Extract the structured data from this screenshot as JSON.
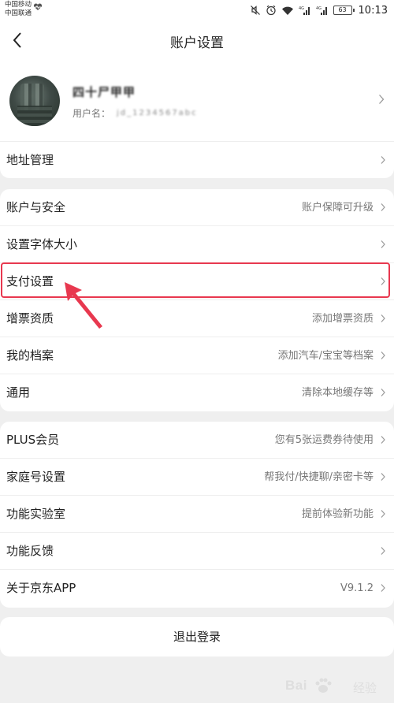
{
  "status_bar": {
    "carrier_1": "中国移动",
    "carrier_2": "中国联通",
    "battery": "63",
    "time": "10:13"
  },
  "nav": {
    "title": "账户设置",
    "back_icon": "chevron-left-icon"
  },
  "profile": {
    "nickname": "四十尸甲甲",
    "username_label": "用户名：",
    "username_value": "jd_1234567abc"
  },
  "group1": [
    {
      "label": "地址管理",
      "value": ""
    }
  ],
  "group2": [
    {
      "label": "账户与安全",
      "value": "账户保障可升级"
    },
    {
      "label": "设置字体大小",
      "value": ""
    },
    {
      "label": "支付设置",
      "value": ""
    },
    {
      "label": "增票资质",
      "value": "添加增票资质"
    },
    {
      "label": "我的档案",
      "value": "添加汽车/宝宝等档案"
    },
    {
      "label": "通用",
      "value": "清除本地缓存等"
    }
  ],
  "group3": [
    {
      "label": "PLUS会员",
      "value": "您有5张运费券待使用"
    },
    {
      "label": "家庭号设置",
      "value": "帮我付/快捷聊/亲密卡等"
    },
    {
      "label": "功能实验室",
      "value": "提前体验新功能"
    },
    {
      "label": "功能反馈",
      "value": ""
    },
    {
      "label": "关于京东APP",
      "value": "V9.1.2"
    }
  ],
  "logout_label": "退出登录",
  "watermark": {
    "text": "Bai",
    "text2": "经验"
  },
  "colors": {
    "highlight": "#e8384f",
    "background": "#efefef"
  }
}
